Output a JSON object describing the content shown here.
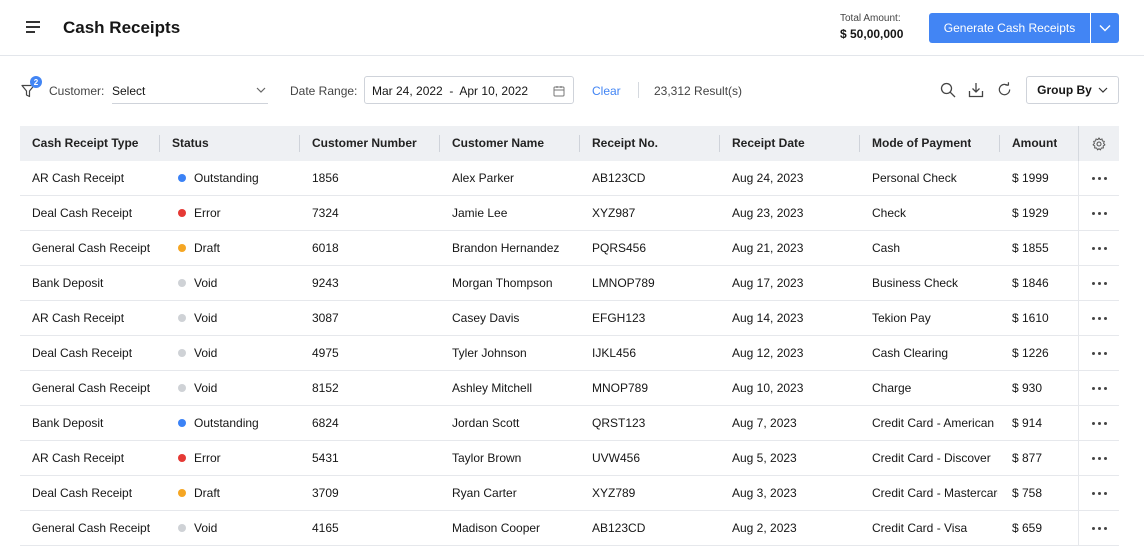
{
  "header": {
    "title": "Cash Receipts",
    "total_label": "Total Amount:",
    "total_value": "$ 50,00,000",
    "generate_label": "Generate Cash Receipts"
  },
  "toolbar": {
    "filter_badge": "2",
    "customer_label": "Customer:",
    "customer_value": "Select",
    "date_label": "Date Range:",
    "date_value": "Mar 24, 2022  -  Apr 10, 2022",
    "clear_label": "Clear",
    "results": "23,312 Result(s)",
    "group_by_label": "Group By",
    "icons": [
      "search-icon",
      "download-icon",
      "refresh-icon"
    ]
  },
  "colors": {
    "accent": "#4285f4",
    "outstanding": "#3b82f6",
    "error": "#e53935",
    "draft": "#f5a623",
    "void": "#cfd2d6"
  },
  "table": {
    "columns": [
      "Cash Receipt Type",
      "Status",
      "Customer Number",
      "Customer Name",
      "Receipt No.",
      "Receipt Date",
      "Mode of Payment",
      "Amount"
    ],
    "rows": [
      {
        "type": "AR Cash Receipt",
        "status": "Outstanding",
        "number": "1856",
        "name": "Alex Parker",
        "receipt": "AB123CD",
        "date": "Aug 24, 2023",
        "mode": "Personal Check",
        "amount": "$ 1999"
      },
      {
        "type": "Deal Cash Receipt",
        "status": "Error",
        "number": "7324",
        "name": "Jamie Lee",
        "receipt": "XYZ987",
        "date": "Aug 23, 2023",
        "mode": "Check",
        "amount": "$ 1929"
      },
      {
        "type": "General Cash Receipt",
        "status": "Draft",
        "number": "6018",
        "name": "Brandon Hernandez",
        "receipt": "PQRS456",
        "date": "Aug 21, 2023",
        "mode": "Cash",
        "amount": "$ 1855"
      },
      {
        "type": "Bank Deposit",
        "status": "Void",
        "number": "9243",
        "name": "Morgan Thompson",
        "receipt": "LMNOP789",
        "date": "Aug 17, 2023",
        "mode": "Business Check",
        "amount": "$ 1846"
      },
      {
        "type": "AR Cash Receipt",
        "status": "Void",
        "number": "3087",
        "name": "Casey Davis",
        "receipt": "EFGH123",
        "date": "Aug 14, 2023",
        "mode": "Tekion Pay",
        "amount": "$ 1610"
      },
      {
        "type": "Deal Cash Receipt",
        "status": "Void",
        "number": "4975",
        "name": "Tyler Johnson",
        "receipt": "IJKL456",
        "date": "Aug 12, 2023",
        "mode": "Cash Clearing",
        "amount": "$ 1226"
      },
      {
        "type": "General Cash Receipt",
        "status": "Void",
        "number": "8152",
        "name": "Ashley Mitchell",
        "receipt": "MNOP789",
        "date": "Aug 10, 2023",
        "mode": "Charge",
        "amount": "$ 930"
      },
      {
        "type": "Bank Deposit",
        "status": "Outstanding",
        "number": "6824",
        "name": "Jordan Scott",
        "receipt": "QRST123",
        "date": "Aug 7, 2023",
        "mode": "Credit Card - American Express",
        "amount": "$ 914"
      },
      {
        "type": "AR Cash Receipt",
        "status": "Error",
        "number": "5431",
        "name": "Taylor Brown",
        "receipt": "UVW456",
        "date": "Aug 5, 2023",
        "mode": "Credit Card - Discover",
        "amount": "$ 877"
      },
      {
        "type": "Deal Cash Receipt",
        "status": "Draft",
        "number": "3709",
        "name": "Ryan Carter",
        "receipt": "XYZ789",
        "date": "Aug 3, 2023",
        "mode": "Credit Card - Mastercard",
        "amount": "$ 758"
      },
      {
        "type": "General Cash Receipt",
        "status": "Void",
        "number": "4165",
        "name": "Madison Cooper",
        "receipt": "AB123CD",
        "date": "Aug 2, 2023",
        "mode": "Credit Card - Visa",
        "amount": "$ 659"
      }
    ]
  }
}
